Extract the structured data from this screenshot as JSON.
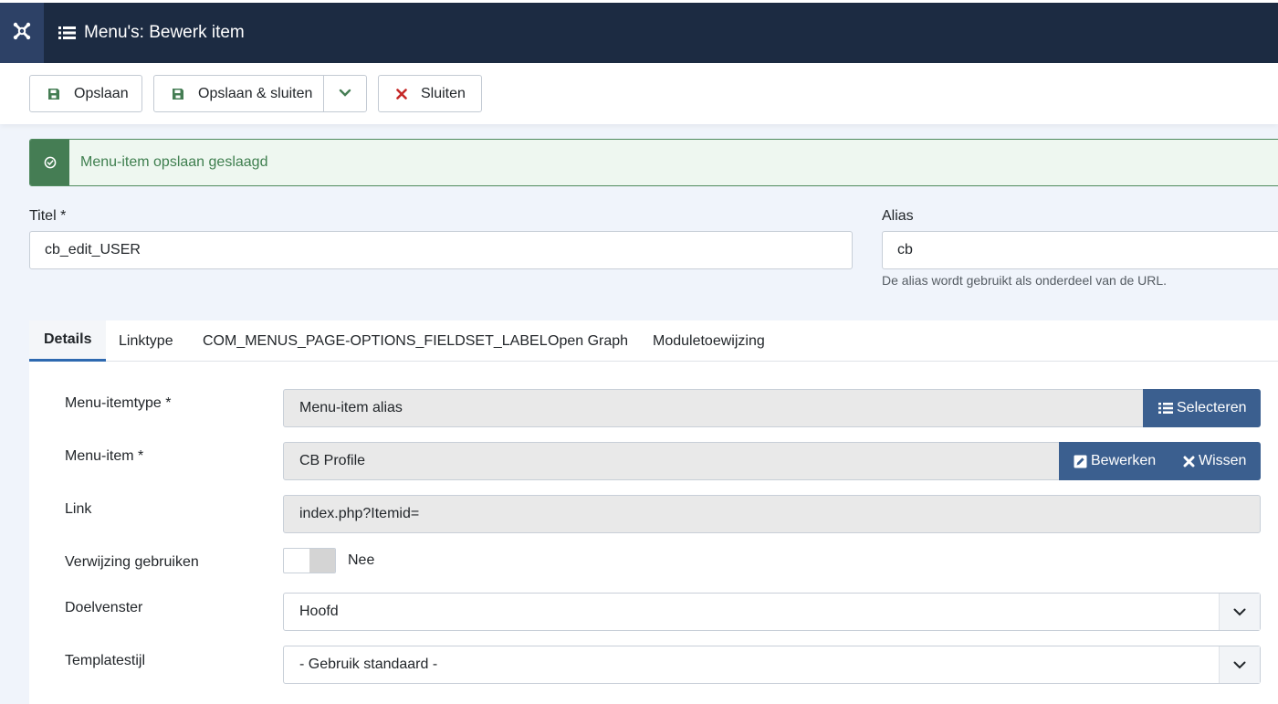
{
  "header": {
    "title": "Menu's: Bewerk item",
    "logo_icon": "joomla-logo-icon",
    "title_icon": "list-icon",
    "bg_color": "#1c2b42"
  },
  "toolbar": {
    "save_label": "Opslaan",
    "save_close_label": "Opslaan & sluiten",
    "close_label": "Sluiten",
    "save_icon": "floppy-disk-icon",
    "dropdown_icon": "chevron-down-icon",
    "close_icon": "x-icon",
    "save_icon_color": "#457d54",
    "close_icon_color": "#c52827"
  },
  "alert": {
    "message": "Menu-item opslaan geslaagd",
    "icon": "check-circle-icon",
    "color": "#457d54"
  },
  "form": {
    "title_label": "Titel *",
    "title_value": "cb_edit_USER",
    "alias_label": "Alias",
    "alias_value": "cb",
    "alias_hint": "De alias wordt gebruikt als onderdeel van de URL."
  },
  "tabs": [
    {
      "label": "Details",
      "active": true
    },
    {
      "label": "Linktype"
    },
    {
      "label": "COM_MENUS_PAGE-OPTIONS_FIELDSET_LABEL"
    },
    {
      "label": "Open Graph"
    },
    {
      "label": "Moduletoewijzing"
    }
  ],
  "details": {
    "type_label": "Menu-itemtype *",
    "type_value": "Menu-item alias",
    "select_button": "Selecteren",
    "item_label": "Menu-item *",
    "item_value": "CB Profile",
    "edit_button": "Bewerken",
    "clear_button": "Wissen",
    "link_label": "Link",
    "link_value": "index.php?Itemid=",
    "redirect_label": "Verwijzing gebruiken",
    "redirect_value": "Nee",
    "target_label": "Doelvenster",
    "target_value": "Hoofd",
    "template_label": "Templatestijl",
    "template_value": "- Gebruik standaard -",
    "button_color": "#3b5f8f"
  }
}
